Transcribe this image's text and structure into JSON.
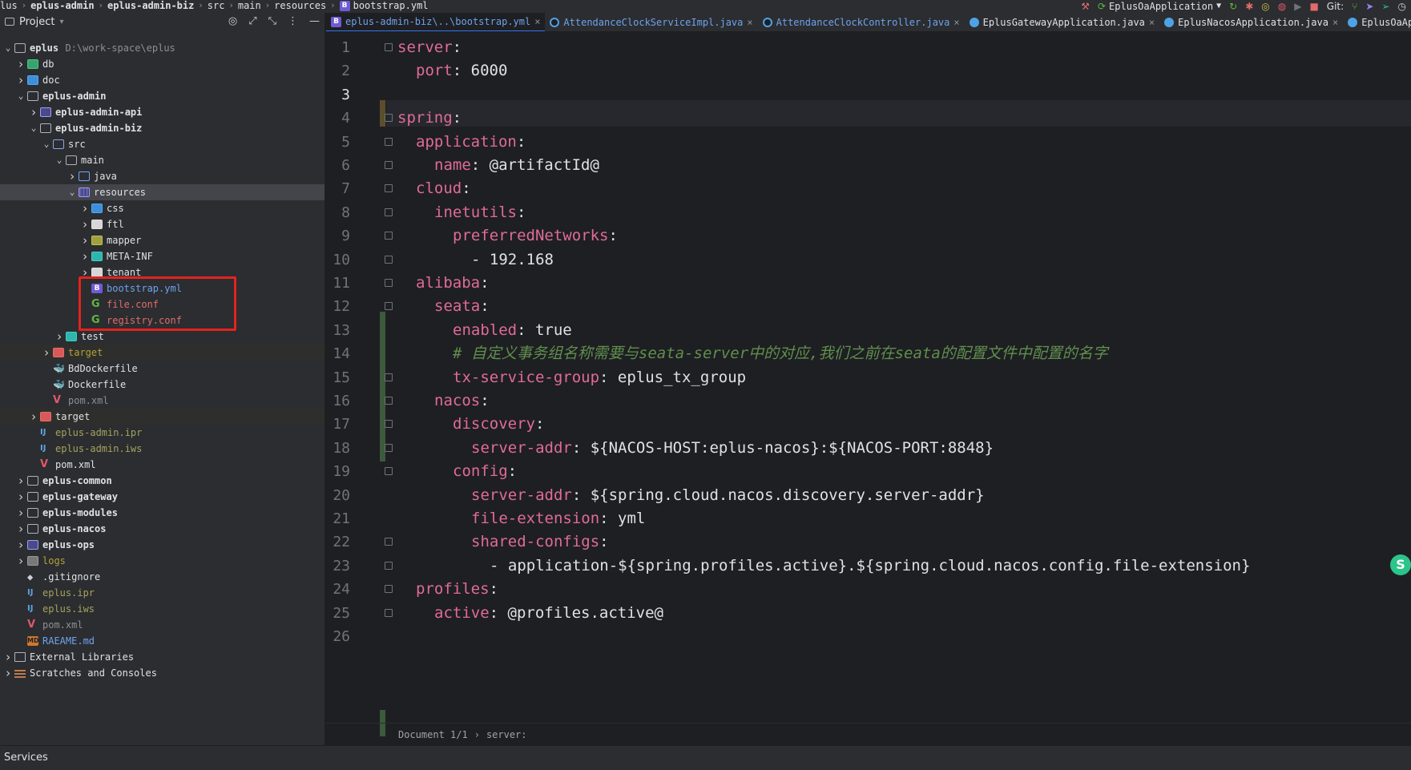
{
  "breadcrumb": [
    "lus",
    "eplus-admin",
    "eplus-admin-biz",
    "src",
    "main",
    "resources",
    "bootstrap.yml"
  ],
  "toolbar": {
    "run_config": "EplusOaApplication",
    "git_label": "Git:"
  },
  "project_panel": {
    "title": "Project",
    "tree": [
      {
        "label": "eplus",
        "hint": "D:\\work-space\\eplus",
        "indent": 0,
        "arrow": "down",
        "icon": "folder",
        "style": "bold"
      },
      {
        "label": "db",
        "indent": 1,
        "arrow": "right",
        "icon": "folder-green"
      },
      {
        "label": "doc",
        "indent": 1,
        "arrow": "right",
        "icon": "folder-blue"
      },
      {
        "label": "eplus-admin",
        "indent": 1,
        "arrow": "down",
        "icon": "folder",
        "style": "bold"
      },
      {
        "label": "eplus-admin-api",
        "indent": 2,
        "arrow": "right",
        "icon": "folder-module",
        "style": "bold"
      },
      {
        "label": "eplus-admin-biz",
        "indent": 2,
        "arrow": "down",
        "icon": "folder",
        "style": "bold"
      },
      {
        "label": "src",
        "indent": 3,
        "arrow": "down",
        "icon": "folder-src"
      },
      {
        "label": "main",
        "indent": 4,
        "arrow": "down",
        "icon": "folder"
      },
      {
        "label": "java",
        "indent": 5,
        "arrow": "right",
        "icon": "folder-java"
      },
      {
        "label": "resources",
        "indent": 5,
        "arrow": "down",
        "icon": "folder-resources",
        "selected": true
      },
      {
        "label": "css",
        "indent": 6,
        "arrow": "right",
        "icon": "folder-blue"
      },
      {
        "label": "ftl",
        "indent": 6,
        "arrow": "right",
        "icon": "folder-white"
      },
      {
        "label": "mapper",
        "indent": 6,
        "arrow": "right",
        "icon": "folder-olive"
      },
      {
        "label": "META-INF",
        "indent": 6,
        "arrow": "right",
        "icon": "folder-teal"
      },
      {
        "label": "tenant",
        "indent": 6,
        "arrow": "right",
        "icon": "folder-white"
      },
      {
        "label": "bootstrap.yml",
        "indent": 6,
        "arrow": "",
        "icon": "file-b",
        "color": "blue"
      },
      {
        "label": "file.conf",
        "indent": 6,
        "arrow": "",
        "icon": "file-g",
        "color": "red"
      },
      {
        "label": "registry.conf",
        "indent": 6,
        "arrow": "",
        "icon": "file-g",
        "color": "red"
      },
      {
        "label": "test",
        "indent": 4,
        "arrow": "right",
        "icon": "folder-teal"
      },
      {
        "label": "target",
        "indent": 3,
        "arrow": "right",
        "icon": "folder-red",
        "color": "yellow",
        "highlight": true
      },
      {
        "label": "BdDockerfile",
        "indent": 3,
        "arrow": "",
        "icon": "file-docker"
      },
      {
        "label": "Dockerfile",
        "indent": 3,
        "arrow": "",
        "icon": "file-docker"
      },
      {
        "label": "pom.xml",
        "indent": 3,
        "arrow": "",
        "icon": "file-v",
        "color": "grey"
      },
      {
        "label": "target",
        "indent": 2,
        "arrow": "right",
        "icon": "folder-red",
        "highlight": true
      },
      {
        "label": "eplus-admin.ipr",
        "indent": 2,
        "arrow": "",
        "icon": "file-ij",
        "color": "olive"
      },
      {
        "label": "eplus-admin.iws",
        "indent": 2,
        "arrow": "",
        "icon": "file-ij",
        "color": "olive"
      },
      {
        "label": "pom.xml",
        "indent": 2,
        "arrow": "",
        "icon": "file-v"
      },
      {
        "label": "eplus-common",
        "indent": 1,
        "arrow": "right",
        "icon": "folder",
        "style": "bold"
      },
      {
        "label": "eplus-gateway",
        "indent": 1,
        "arrow": "right",
        "icon": "folder",
        "style": "bold"
      },
      {
        "label": "eplus-modules",
        "indent": 1,
        "arrow": "right",
        "icon": "folder",
        "style": "bold"
      },
      {
        "label": "eplus-nacos",
        "indent": 1,
        "arrow": "right",
        "icon": "folder",
        "style": "bold"
      },
      {
        "label": "eplus-ops",
        "indent": 1,
        "arrow": "right",
        "icon": "folder-module",
        "style": "bold"
      },
      {
        "label": "logs",
        "indent": 1,
        "arrow": "right",
        "icon": "folder-grey",
        "color": "yellow"
      },
      {
        "label": ".gitignore",
        "indent": 1,
        "arrow": "",
        "icon": "file-git"
      },
      {
        "label": "eplus.ipr",
        "indent": 1,
        "arrow": "",
        "icon": "file-ij",
        "color": "olive"
      },
      {
        "label": "eplus.iws",
        "indent": 1,
        "arrow": "",
        "icon": "file-ij",
        "color": "olive"
      },
      {
        "label": "pom.xml",
        "indent": 1,
        "arrow": "",
        "icon": "file-v",
        "color": "grey"
      },
      {
        "label": "RAEAME.md",
        "indent": 1,
        "arrow": "",
        "icon": "file-md",
        "color": "blue"
      },
      {
        "label": "External Libraries",
        "indent": 0,
        "arrow": "right",
        "icon": "lib"
      },
      {
        "label": "Scratches and Consoles",
        "indent": 0,
        "arrow": "right",
        "icon": "scratch"
      }
    ]
  },
  "tabs": [
    {
      "label": "eplus-admin-biz\\..\\bootstrap.yml",
      "icon": "b",
      "active": true
    },
    {
      "label": "AttendanceClockServiceImpl.java",
      "icon": "j"
    },
    {
      "label": "AttendanceClockController.java",
      "icon": "j"
    },
    {
      "label": "EplusGatewayApplication.java",
      "icon": "jb",
      "plain": true
    },
    {
      "label": "EplusNacosApplication.java",
      "icon": "jb",
      "plain": true
    },
    {
      "label": "EplusOaApplication.java",
      "icon": "jb",
      "plain": true
    }
  ],
  "code_lines": [
    {
      "n": "1",
      "indent": 0,
      "key": "server",
      "sep": ":",
      "value": ""
    },
    {
      "n": "2",
      "indent": 1,
      "key": "port",
      "sep": ":",
      "value": " 6000"
    },
    {
      "n": "3",
      "indent": 0,
      "key": "",
      "sep": "",
      "value": ""
    },
    {
      "n": "4",
      "indent": 0,
      "key": "spring",
      "sep": ":",
      "value": ""
    },
    {
      "n": "5",
      "indent": 1,
      "key": "application",
      "sep": ":",
      "value": ""
    },
    {
      "n": "6",
      "indent": 2,
      "key": "name",
      "sep": ":",
      "value": " @artifactId@"
    },
    {
      "n": "7",
      "indent": 1,
      "key": "cloud",
      "sep": ":",
      "value": ""
    },
    {
      "n": "8",
      "indent": 2,
      "key": "inetutils",
      "sep": ":",
      "value": ""
    },
    {
      "n": "9",
      "indent": 3,
      "key": "preferredNetworks",
      "sep": ":",
      "value": ""
    },
    {
      "n": "10",
      "indent": 4,
      "key": "",
      "sep": "",
      "value": "- 192.168"
    },
    {
      "n": "11",
      "indent": 1,
      "key": "alibaba",
      "sep": ":",
      "value": ""
    },
    {
      "n": "12",
      "indent": 2,
      "key": "seata",
      "sep": ":",
      "value": ""
    },
    {
      "n": "13",
      "indent": 3,
      "key": "enabled",
      "sep": ":",
      "value": " true"
    },
    {
      "n": "14",
      "indent": 3,
      "key": "",
      "sep": "",
      "value": "",
      "comment": "# 自定义事务组名称需要与seata-server中的对应,我们之前在seata的配置文件中配置的名字"
    },
    {
      "n": "15",
      "indent": 3,
      "key": "tx-service-group",
      "sep": ":",
      "value": " eplus_tx_group"
    },
    {
      "n": "16",
      "indent": 2,
      "key": "nacos",
      "sep": ":",
      "value": ""
    },
    {
      "n": "17",
      "indent": 3,
      "key": "discovery",
      "sep": ":",
      "value": ""
    },
    {
      "n": "18",
      "indent": 4,
      "key": "server-addr",
      "sep": ":",
      "value": " ${NACOS-HOST:eplus-nacos}:${NACOS-PORT:8848}"
    },
    {
      "n": "19",
      "indent": 3,
      "key": "config",
      "sep": ":",
      "value": ""
    },
    {
      "n": "20",
      "indent": 4,
      "key": "server-addr",
      "sep": ":",
      "value": " ${spring.cloud.nacos.discovery.server-addr}"
    },
    {
      "n": "21",
      "indent": 4,
      "key": "file-extension",
      "sep": ":",
      "value": " yml"
    },
    {
      "n": "22",
      "indent": 4,
      "key": "shared-configs",
      "sep": ":",
      "value": ""
    },
    {
      "n": "23",
      "indent": 5,
      "key": "",
      "sep": "",
      "value": "- application-${spring.profiles.active}.${spring.cloud.nacos.config.file-extension}"
    },
    {
      "n": "24",
      "indent": 1,
      "key": "profiles",
      "sep": ":",
      "value": ""
    },
    {
      "n": "25",
      "indent": 2,
      "key": "active",
      "sep": ":",
      "value": " @profiles.active@"
    },
    {
      "n": "26",
      "indent": 0,
      "key": "",
      "sep": "",
      "value": ""
    }
  ],
  "editor_breadcrumb": [
    "Document 1/1",
    "server:"
  ],
  "status_bar": {
    "label": "Services"
  },
  "colors": {
    "highlight_box": "#e3231f",
    "yaml_key": "#e06b9a",
    "comment": "#5f8f4e",
    "accent": "#3574f0"
  }
}
